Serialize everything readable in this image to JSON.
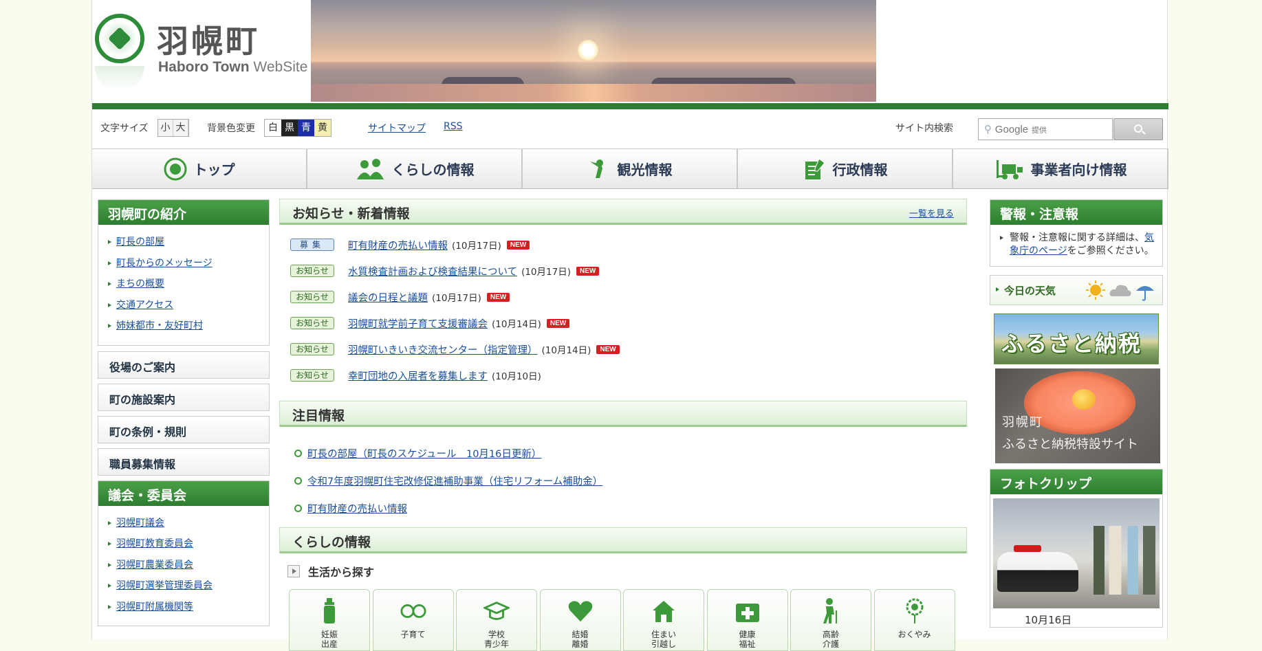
{
  "site": {
    "name": "羽幌町",
    "subtitle_bold": "Haboro Town",
    "subtitle": " WebSite"
  },
  "toolbar": {
    "font_size_label": "文字サイズ",
    "font_small": "小",
    "font_large": "大",
    "bg_label": "背景色変更",
    "bg_white": "白",
    "bg_black": "黒",
    "bg_blue": "青",
    "bg_yellow": "黄",
    "sitemap": "サイトマップ",
    "rss": "RSS",
    "search_label": "サイト内検索",
    "google": "Google",
    "google_provided": "提供"
  },
  "nav": {
    "top": "トップ",
    "living": "くらしの情報",
    "tourism": "観光情報",
    "admin": "行政情報",
    "business": "事業者向け情報"
  },
  "left": {
    "intro_title": "羽幌町の紹介",
    "intro_links": [
      "町長の部屋",
      "町長からのメッセージ",
      "まちの概要",
      "交通アクセス",
      "姉妹都市・友好町村"
    ],
    "office_guide": "役場のご案内",
    "facilities": "町の施設案内",
    "regulations": "町の条例・規則",
    "jobs": "職員募集情報",
    "council_title": "議会・委員会",
    "council_links": [
      "羽幌町議会",
      "羽幌町教育委員会",
      "羽幌町農業委員会",
      "羽幌町選挙管理委員会",
      "羽幌町附属機関等"
    ]
  },
  "news": {
    "title": "お知らせ・新着情報",
    "more": "一覧を見る",
    "new_badge": "NEW",
    "items": [
      {
        "cat": "募集",
        "title": "町有財産の売払い情報",
        "date": "(10月17日)"
      },
      {
        "cat": "お知らせ",
        "title": "水質検査計画および検査結果について",
        "date": "(10月17日)"
      },
      {
        "cat": "お知らせ",
        "title": "議会の日程と議題",
        "date": "(10月17日)"
      },
      {
        "cat": "お知らせ",
        "title": "羽幌町就学前子育て支援審議会",
        "date": "(10月14日)"
      },
      {
        "cat": "お知らせ",
        "title": "羽幌町いきいき交流センター（指定管理）",
        "date": "(10月14日)"
      },
      {
        "cat": "お知らせ",
        "title": "幸町団地の入居者を募集します",
        "date": "(10月10日)"
      }
    ]
  },
  "featured": {
    "title": "注目情報",
    "items": [
      "町長の部屋（町長のスケジュール　10月16日更新）",
      "令和7年度羽幌町住宅改修促進補助事業（住宅リフォーム補助金）",
      "町有財産の売払い情報"
    ]
  },
  "living": {
    "title": "くらしの情報",
    "subhead": "生活から探す",
    "categories": [
      "妊娠\n出産",
      "子育て",
      "学校\n青少年",
      "結婚\n離婚",
      "住まい\n引越し",
      "健康\n福祉",
      "高齢\n介護",
      "おくやみ"
    ]
  },
  "right": {
    "alert_title": "警報・注意報",
    "alert_pre": "警報・注意報に関する詳細は、",
    "alert_link": "気象庁のページ",
    "alert_post": "をご参照ください。",
    "weather": "今日の天気",
    "furusato": "ふるさと納税",
    "special_1": "羽幌町",
    "special_2": "ふるさと納税特設サイト",
    "photo_title": "フォトクリップ",
    "photo_date": "10月16日"
  },
  "colors": {
    "brand_green": "#2e7d32",
    "link_blue": "#1a4f9c",
    "new_red": "#d42020"
  }
}
